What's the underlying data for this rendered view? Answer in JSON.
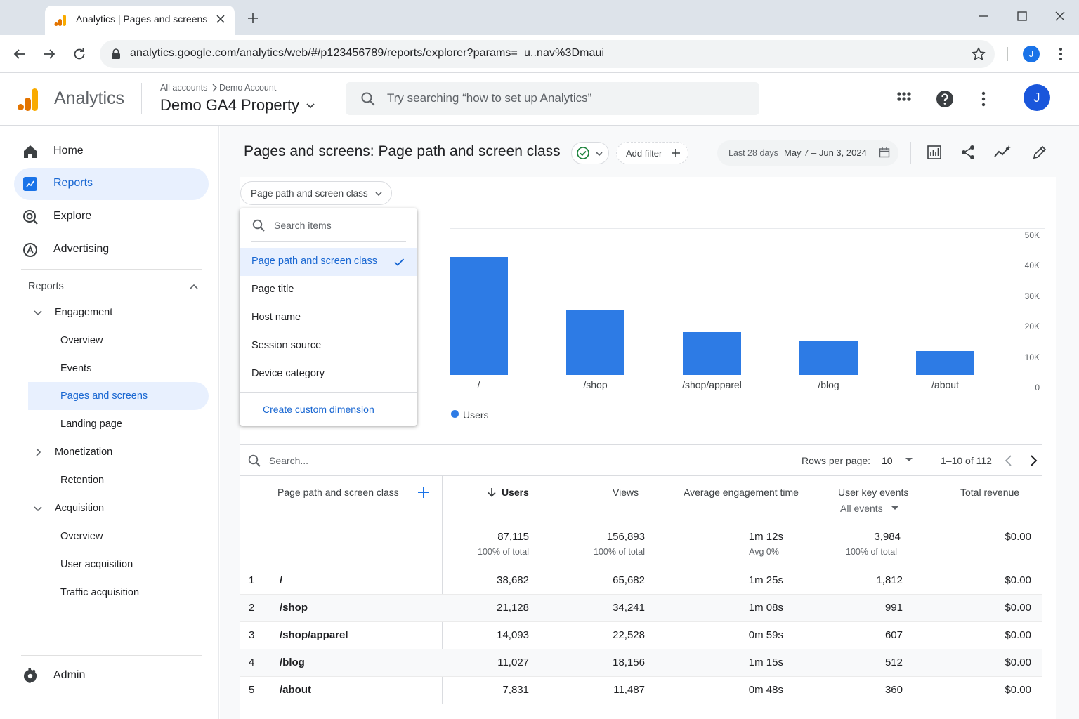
{
  "browser": {
    "tab_title": "Analytics | Pages and screens",
    "url": "analytics.google.com/analytics/web/#/p123456789/reports/explorer?params=_u..nav%3Dmaui",
    "profile_initial": "J"
  },
  "header": {
    "product_name": "Analytics",
    "breadcrumb_root": "All accounts",
    "breadcrumb_account": "Demo Account",
    "property_name": "Demo GA4 Property",
    "search_placeholder": "Try searching “how to set up Analytics”",
    "avatar_initial": "J"
  },
  "sidebar": {
    "nav": [
      {
        "label": "Home",
        "icon": "home-icon"
      },
      {
        "label": "Reports",
        "icon": "reports-icon"
      },
      {
        "label": "Explore",
        "icon": "explore-icon"
      },
      {
        "label": "Advertising",
        "icon": "advertising-icon"
      }
    ],
    "section_label": "Reports",
    "engagement": "Engagement",
    "engagement_items": [
      "Overview",
      "Events",
      "Pages and screens",
      "Landing page"
    ],
    "monetization": "Monetization",
    "retention": "Retention",
    "acquisition": "Acquisition",
    "acquisition_items": [
      "Overview",
      "User acquisition",
      "Traffic acquisition"
    ],
    "admin": "Admin"
  },
  "report": {
    "title": "Pages and screens: Page path and screen class",
    "add_filter": "Add filter",
    "date_range_label": "Last 28 days",
    "date_range": "May 7 – Jun 3, 2024",
    "dimension_selector": "Page path and screen class"
  },
  "dimension_menu": {
    "search_placeholder": "Search items",
    "items": [
      "Page path and screen class",
      "Page title",
      "Host name",
      "Session source",
      "Device category"
    ],
    "selected_index": 0,
    "create_custom": "Create custom dimension"
  },
  "chart_data": {
    "type": "bar",
    "categories": [
      "/",
      "/shop",
      "/shop/apparel",
      "/blog",
      "/about"
    ],
    "series": [
      {
        "name": "Users",
        "values": [
          38682,
          21128,
          14093,
          11027,
          7831
        ]
      }
    ],
    "y_ticks": [
      "50K",
      "40K",
      "30K",
      "20K",
      "10K",
      "0"
    ],
    "ylim": [
      0,
      50000
    ],
    "legend_position": "bottom-left",
    "color": "#2d7be5"
  },
  "table": {
    "search_placeholder": "Search...",
    "rows_per_page_label": "Rows per page:",
    "rows_per_page": "10",
    "pagination": "1–10 of 112",
    "headers": {
      "dimension": "Page path and screen class",
      "users": "Users",
      "views": "Views",
      "engagement": "Average engagement time",
      "key_events": "User key events",
      "key_events_filter": "All events",
      "revenue": "Total revenue"
    },
    "totals": {
      "users": "87,115",
      "users_sub": "100% of total",
      "views": "156,893",
      "views_sub": "100% of total",
      "engagement": "1m 12s",
      "engagement_sub": "Avg 0%",
      "key_events": "3,984",
      "key_events_sub": "100% of total",
      "revenue": "$0.00"
    },
    "rows": [
      {
        "rank": "1",
        "path": "/",
        "users": "38,682",
        "views": "65,682",
        "engagement": "1m 25s",
        "key_events": "1,812",
        "revenue": "$0.00"
      },
      {
        "rank": "2",
        "path": "/shop",
        "users": "21,128",
        "views": "34,241",
        "engagement": "1m 08s",
        "key_events": "991",
        "revenue": "$0.00"
      },
      {
        "rank": "3",
        "path": "/shop/apparel",
        "users": "14,093",
        "views": "22,528",
        "engagement": "0m 59s",
        "key_events": "607",
        "revenue": "$0.00"
      },
      {
        "rank": "4",
        "path": "/blog",
        "users": "11,027",
        "views": "18,156",
        "engagement": "1m 15s",
        "key_events": "512",
        "revenue": "$0.00"
      },
      {
        "rank": "5",
        "path": "/about",
        "users": "7,831",
        "views": "11,487",
        "engagement": "0m 48s",
        "key_events": "360",
        "revenue": "$0.00"
      }
    ]
  }
}
